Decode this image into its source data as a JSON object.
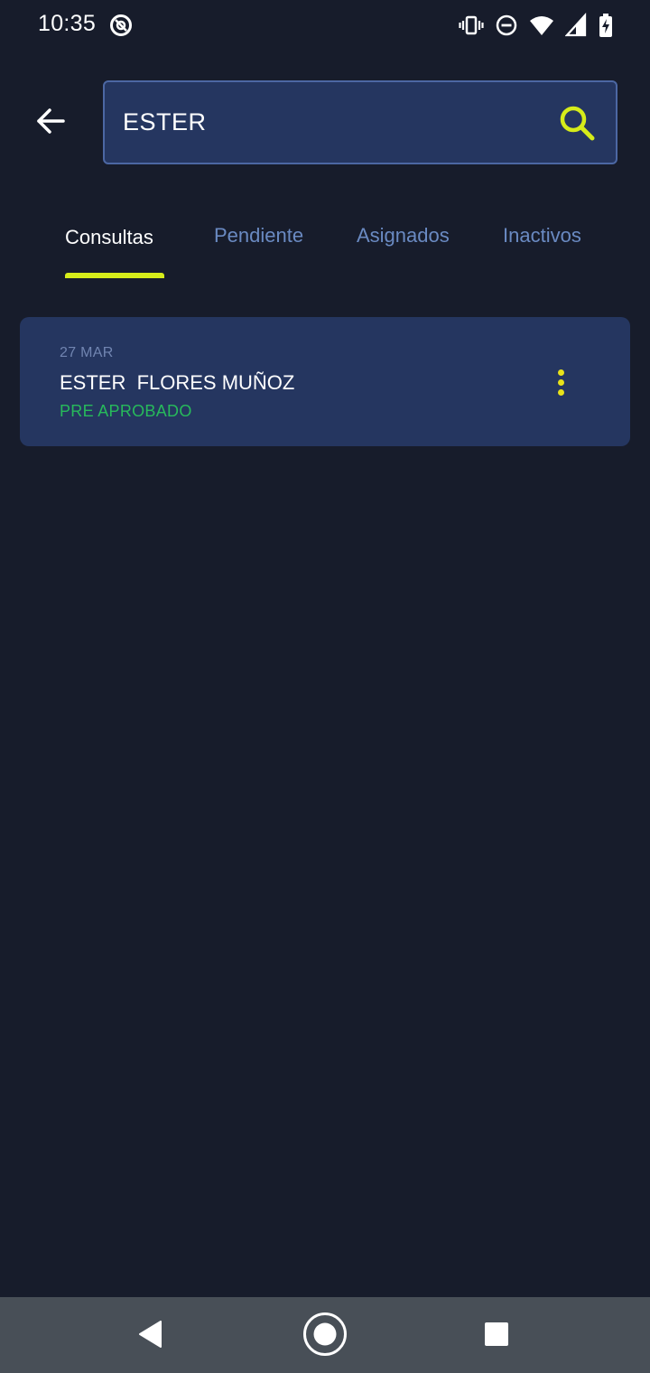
{
  "status_bar": {
    "time": "10:35",
    "left_icons": [
      "at-sign-icon"
    ],
    "right_icons": [
      "vibrate-icon",
      "do-not-disturb-icon",
      "wifi-icon",
      "signal-icon",
      "battery-charging-icon"
    ]
  },
  "header": {
    "back_icon": "arrow-left-icon",
    "search": {
      "value": "ESTER",
      "icon": "search-icon"
    }
  },
  "tabs": [
    {
      "label": "Consultas",
      "active": true
    },
    {
      "label": "Pendiente",
      "active": false
    },
    {
      "label": "Asignados",
      "active": false
    },
    {
      "label": "Inactivos",
      "active": false
    }
  ],
  "results": [
    {
      "date": "27 MAR",
      "name": "ESTER  FLORES MUÑOZ",
      "status": "PRE APROBADO",
      "menu_icon": "more-vertical-icon"
    }
  ],
  "colors": {
    "background": "#171c2b",
    "card": "#253660",
    "accent": "#d6ec1a",
    "status_ok": "#27ba5b",
    "tab_inactive": "#6a8ac2"
  },
  "nav_bar": {
    "icons": [
      "back-triangle-icon",
      "home-circle-icon",
      "recents-square-icon"
    ]
  }
}
